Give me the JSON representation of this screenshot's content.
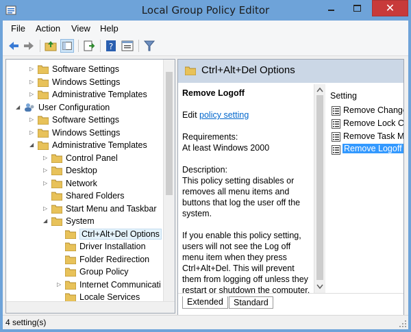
{
  "window": {
    "title": "Local Group Policy Editor"
  },
  "menubar": {
    "items": [
      "File",
      "Action",
      "View",
      "Help"
    ]
  },
  "tree": {
    "rows": [
      {
        "label": "Software Settings",
        "depth": 2,
        "expander": "collapsed"
      },
      {
        "label": "Windows Settings",
        "depth": 2,
        "expander": "collapsed"
      },
      {
        "label": "Administrative Templates",
        "depth": 2,
        "expander": "collapsed"
      },
      {
        "label": "User Configuration",
        "depth": 1,
        "expander": "expanded",
        "icon": "user"
      },
      {
        "label": "Software Settings",
        "depth": 2,
        "expander": "collapsed"
      },
      {
        "label": "Windows Settings",
        "depth": 2,
        "expander": "collapsed"
      },
      {
        "label": "Administrative Templates",
        "depth": 2,
        "expander": "expanded"
      },
      {
        "label": "Control Panel",
        "depth": 3,
        "expander": "collapsed"
      },
      {
        "label": "Desktop",
        "depth": 3,
        "expander": "collapsed"
      },
      {
        "label": "Network",
        "depth": 3,
        "expander": "collapsed"
      },
      {
        "label": "Shared Folders",
        "depth": 3,
        "expander": "none"
      },
      {
        "label": "Start Menu and Taskbar",
        "depth": 3,
        "expander": "collapsed"
      },
      {
        "label": "System",
        "depth": 3,
        "expander": "expanded"
      },
      {
        "label": "Ctrl+Alt+Del Options",
        "depth": 4,
        "expander": "none",
        "selected": true
      },
      {
        "label": "Driver Installation",
        "depth": 4,
        "expander": "none"
      },
      {
        "label": "Folder Redirection",
        "depth": 4,
        "expander": "none"
      },
      {
        "label": "Group Policy",
        "depth": 4,
        "expander": "none"
      },
      {
        "label": "Internet Communicati",
        "depth": 4,
        "expander": "collapsed"
      },
      {
        "label": "Locale Services",
        "depth": 4,
        "expander": "none"
      }
    ]
  },
  "right": {
    "header": "Ctrl+Alt+Del Options",
    "policy_title": "Remove Logoff",
    "edit_prefix": "Edit ",
    "edit_link": "policy setting ",
    "requirements_label": "Requirements:",
    "requirements_value": "At least Windows 2000",
    "description_label": "Description:",
    "description_p1": "This policy setting disables or removes all menu items and buttons that log the user off the system.",
    "description_p2": "If you enable this policy setting, users will not see the Log off menu item when they press Ctrl+Alt+Del. This will prevent them from logging off unless they restart or shutdown the computer,",
    "column_header": "Setting",
    "settings": [
      {
        "label": "Remove Change",
        "selected": false
      },
      {
        "label": "Remove Lock Co",
        "selected": false
      },
      {
        "label": "Remove Task M",
        "selected": false
      },
      {
        "label": "Remove Logoff",
        "selected": true
      }
    ],
    "tabs": [
      "Extended",
      "Standard"
    ],
    "active_tab": "Extended"
  },
  "status": {
    "text": "4 setting(s)"
  },
  "colors": {
    "titlebar": "#6ea3d9",
    "close": "#c83a3a",
    "selection": "#3399ff",
    "header": "#cbd7e6",
    "folder": "#e8c25a"
  }
}
